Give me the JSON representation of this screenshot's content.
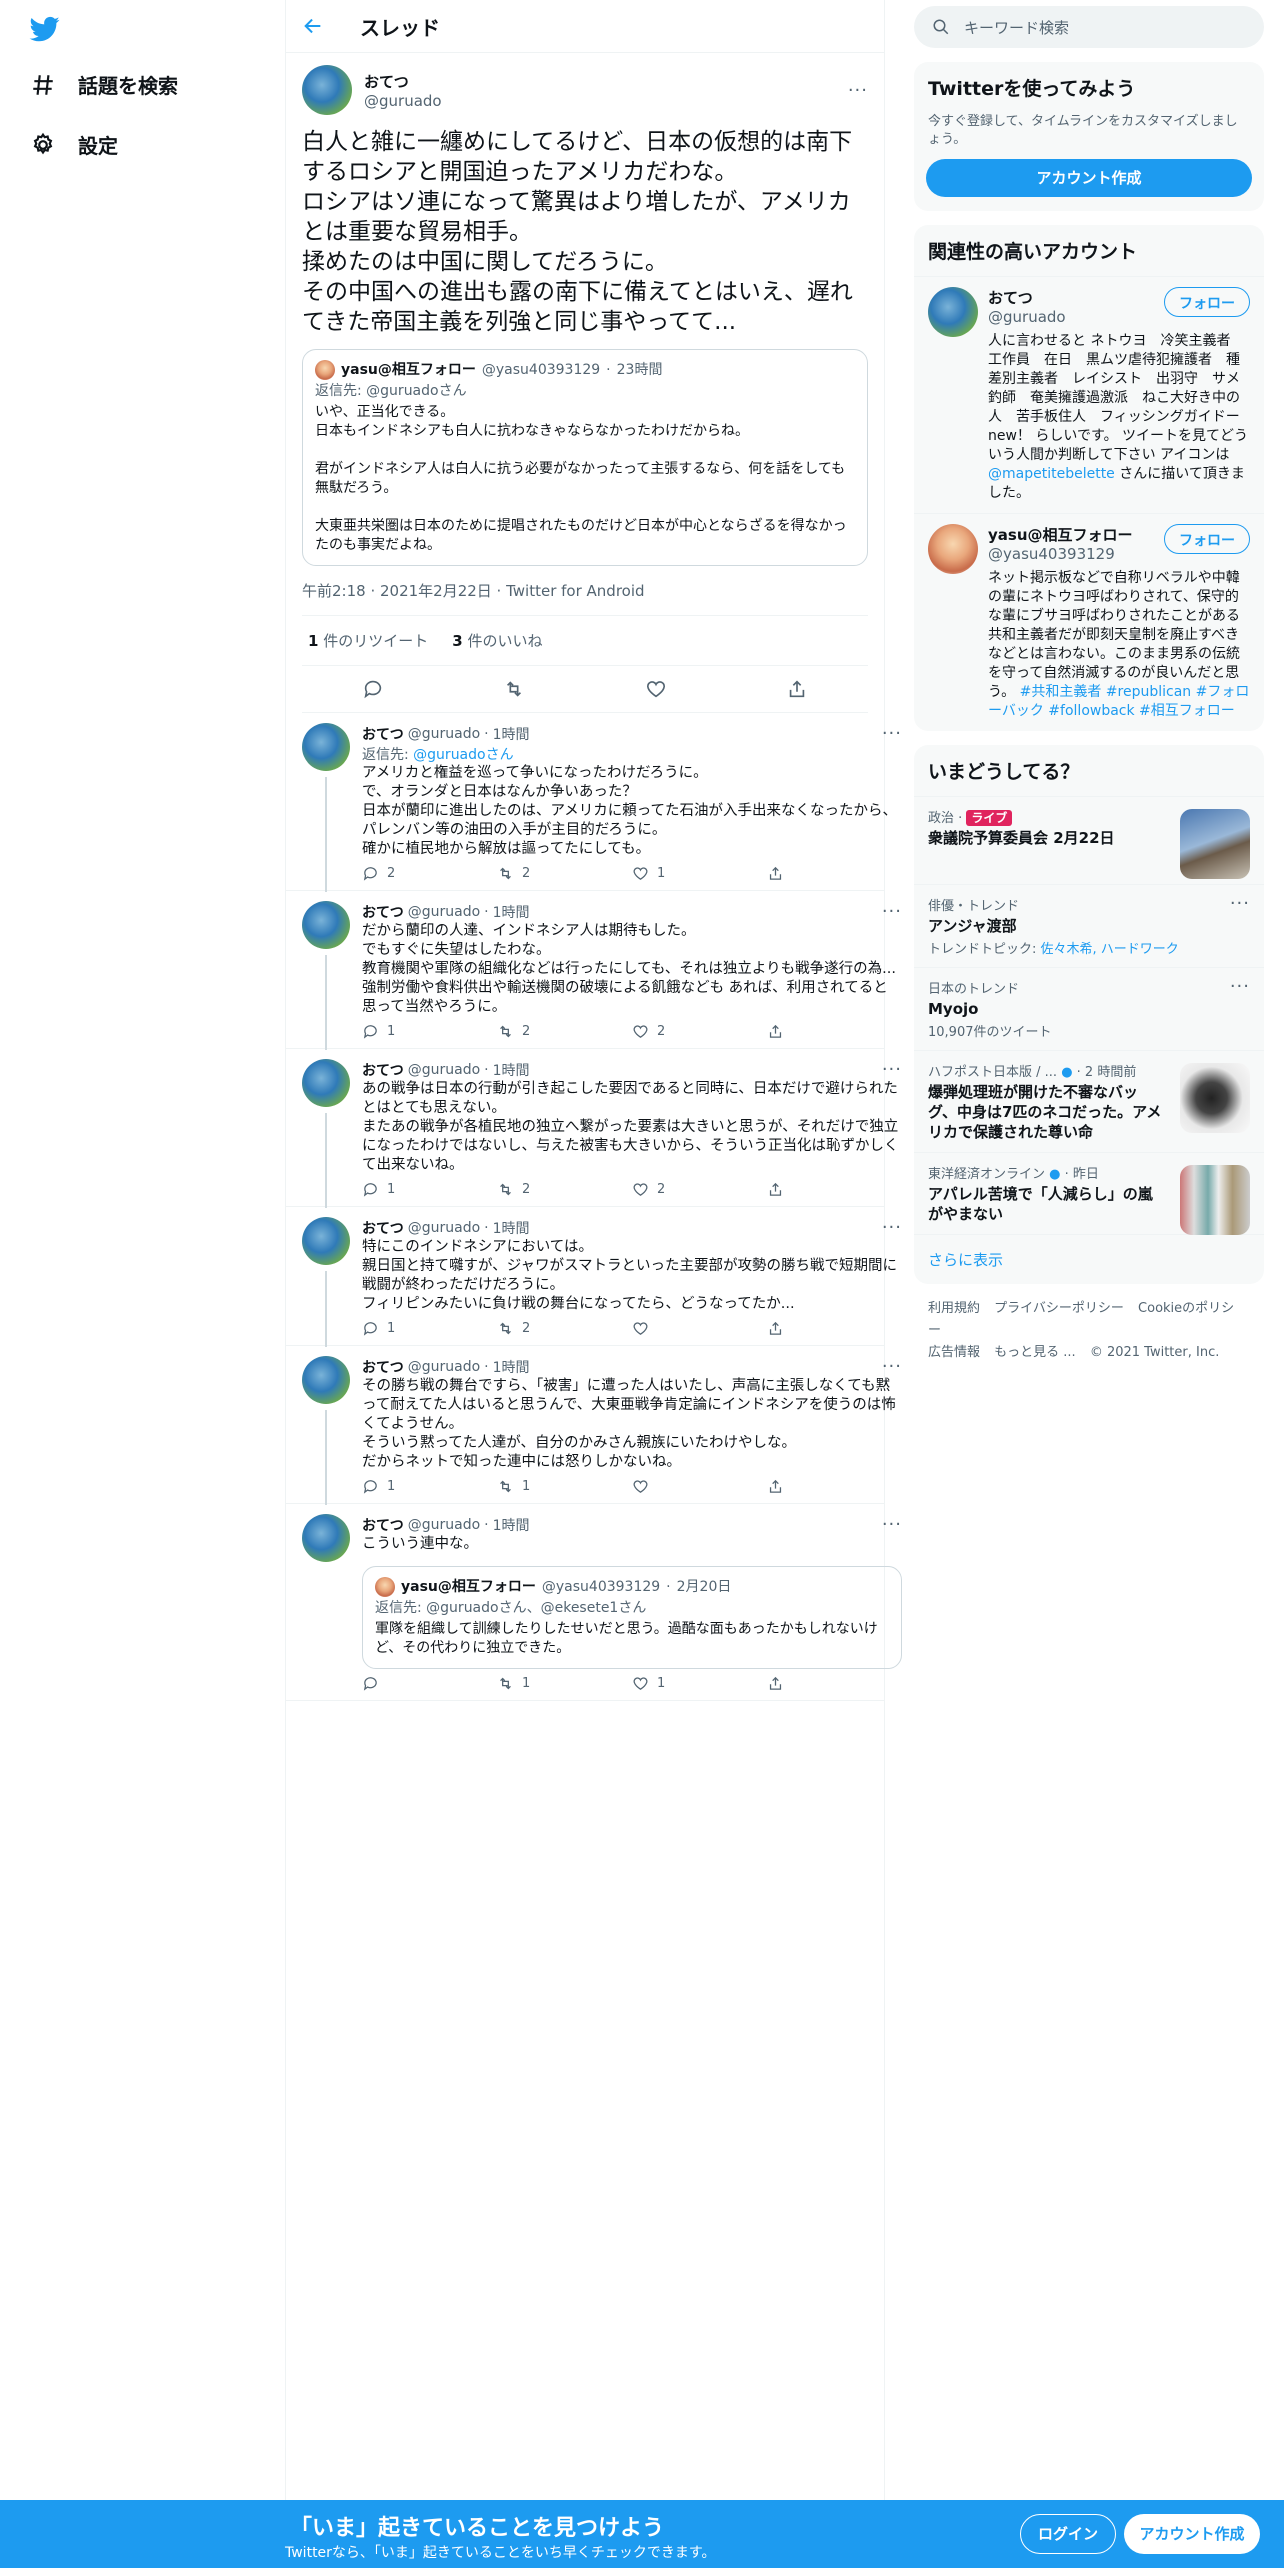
{
  "nav": {
    "explore_label": "話題を検索",
    "settings_label": "設定"
  },
  "header": {
    "title": "スレッド"
  },
  "focus_tweet": {
    "name": "おてつ",
    "handle": "@guruado",
    "text": "白人と雑に一纏めにしてるけど、日本の仮想的は南下するロシアと開国迫ったアメリカだわな。\nロシアはソ連になって驚異はより増したが、アメリカとは重要な貿易相手。\n揉めたのは中国に関してだろうに。\nその中国への進出も露の南下に備えてとはいえ、遅れてきた帝国主義を列強と同じ事やってて...",
    "quote": {
      "name": "yasu@相互フォロー",
      "handle": "@yasu40393129",
      "time": "23時間",
      "reply_to_label": "返信先:",
      "reply_to": "@guruadoさん",
      "text": "いや、正当化できる。\n日本もインドネシアも白人に抗わなきゃならなかったわけだからね。\n\n君がインドネシア人は白人に抗う必要がなかったって主張するなら、何を話をしても無駄だろう。\n\n大東亜共栄圏は日本のために提唱されたものだけど日本が中心とならざるを得なかったのも事実だよね。"
    },
    "meta": "午前2:18 · 2021年2月22日 · Twitter for Android",
    "retweets_count": "1",
    "retweets_label": "件のリツイート",
    "likes_count": "3",
    "likes_label": "件のいいね"
  },
  "replies": [
    {
      "name": "おてつ",
      "handle": "@guruado",
      "time": "1時間",
      "reply_to_label": "返信先:",
      "reply_to": "@guruadoさん",
      "text": "アメリカと権益を巡って争いになったわけだろうに。\nで、オランダと日本はなんか争いあった？\n日本が蘭印に進出したのは、アメリカに頼ってた石油が入手出来なくなったから、パレンバン等の油田の入手が主目的だろうに。\n確かに植民地から解放は謳ってたにしても。",
      "replies": "2",
      "retweets": "2",
      "likes": "1"
    },
    {
      "name": "おてつ",
      "handle": "@guruado",
      "time": "1時間",
      "text": "だから蘭印の人達、インドネシア人は期待もした。\nでもすぐに失望はしたわな。\n教育機関や軍隊の組織化などは行ったにしても、それは独立よりも戦争遂行の為...強制労働や食料供出や輸送機関の破壊による飢餓なども あれば、利用されてると思って当然やろうに。",
      "replies": "1",
      "retweets": "2",
      "likes": "2"
    },
    {
      "name": "おてつ",
      "handle": "@guruado",
      "time": "1時間",
      "text": "あの戦争は日本の行動が引き起こした要因であると同時に、日本だけで避けられたとはとても思えない。\nまたあの戦争が各植民地の独立へ繋がった要素は大きいと思うが、それだけで独立になったわけではないし、与えた被害も大きいから、そういう正当化は恥ずかしくて出来ないね。",
      "replies": "1",
      "retweets": "2",
      "likes": "2"
    },
    {
      "name": "おてつ",
      "handle": "@guruado",
      "time": "1時間",
      "text": "特にこのインドネシアにおいては。\n親日国と持て囃すが、ジャワがスマトラといった主要部が攻勢の勝ち戦で短期間に戦闘が終わっただけだろうに。\nフィリピンみたいに負け戦の舞台になってたら、どうなってたか...",
      "replies": "1",
      "retweets": "2",
      "likes": ""
    },
    {
      "name": "おてつ",
      "handle": "@guruado",
      "time": "1時間",
      "text": "その勝ち戦の舞台ですら、「被害」に遭った人はいたし、声高に主張しなくても黙って耐えてた人はいると思うんで、大東亜戦争肯定論にインドネシアを使うのは怖くてようせん。\nそういう黙ってた人達が、自分のかみさん親族にいたわけやしな。\nだからネットで知った連中には怒りしかないね。",
      "replies": "1",
      "retweets": "1",
      "likes": ""
    },
    {
      "name": "おてつ",
      "handle": "@guruado",
      "time": "1時間",
      "text": "こういう連中な。",
      "quote": {
        "name": "yasu@相互フォロー",
        "handle": "@yasu40393129",
        "time": "2月20日",
        "reply_to_label": "返信先:",
        "reply_to": "@guruadoさん、@ekesete1さん",
        "text": "軍隊を組織して訓練したりしたせいだと思う。過酷な面もあったかもしれないけど、その代わりに独立できた。"
      },
      "replies": "",
      "retweets": "1",
      "likes": "1"
    }
  ],
  "search": {
    "placeholder": "キーワード検索"
  },
  "signup_card": {
    "title": "Twitterを使ってみよう",
    "desc": "今すぐ登録して、タイムラインをカスタマイズしましょう。",
    "button": "アカウント作成"
  },
  "relevant": {
    "title": "関連性の高いアカウント",
    "follow_label": "フォロー",
    "accounts": [
      {
        "name": "おてつ",
        "handle": "@guruado",
        "bio": "人に言わせると ネトウヨ　冷笑主義者　工作員　在日　黒ムツ虐待犯擁護者　種差別主義者　レイシスト　出羽守　サメ釣師　奄美擁護過激派　ねこ大好き中の人　苦手板住人　フィッシングガイドーnew！ らしいです。 ツイートを見てどういう人間か判断して下さい アイコンは",
        "bio_link": "@mapetitebelette",
        "bio_tail": "さんに描いて頂きました。"
      },
      {
        "name": "yasu@相互フォロー",
        "handle": "@yasu40393129",
        "bio": "ネット掲示板などで自称リベラルや中韓の輩にネトウヨ呼ばわりされて、保守的な輩にブサヨ呼ばわりされたことがある共和主義者だが即刻天皇制を廃止すべきなどとは言わない。このまま男系の伝統を守って自然消滅するのが良いんだと思う。",
        "bio_link": "#共和主義者 #republican #フォローバック #followback #相互フォロー"
      }
    ]
  },
  "trends": {
    "title": "いまどうしてる？",
    "items": [
      {
        "ctx": "政治 ·",
        "live": "ライブ",
        "title": "衆議院予算委員会 2月22日"
      },
      {
        "ctx": "俳優・トレンド",
        "title": "アンジャ渡部",
        "sub_label": "トレンドトピック:",
        "sub": "佐々木希, ハードワーク"
      },
      {
        "ctx": "日本のトレンド",
        "title": "Myojo",
        "sub": "10,907件のツイート"
      },
      {
        "ctx": "ハフポスト日本版 / ...",
        "time": "· 2 時間前",
        "title": "爆弾処理班が開けた不審なバッグ、中身は7匹のネコだった。アメリカで保護された尊い命"
      },
      {
        "ctx": "東洋経済オンライン",
        "time": "· 昨日",
        "title": "アパレル苦境で「人減らし」の嵐がやまない"
      }
    ],
    "more": "さらに表示"
  },
  "footer": {
    "links": [
      "利用規約",
      "プライバシーポリシー",
      "Cookieのポリシー",
      "広告情報",
      "もっと見る ...",
      "© 2021 Twitter, Inc."
    ]
  },
  "bottom_bar": {
    "title": "「いま」起きていることを見つけよう",
    "subtitle": "Twitterなら、「いま」起きていることをいち早くチェックできます。",
    "login": "ログイン",
    "signup": "アカウント作成"
  },
  "colors": {
    "accent": "#1d9bf0",
    "live": "#e0245e"
  }
}
